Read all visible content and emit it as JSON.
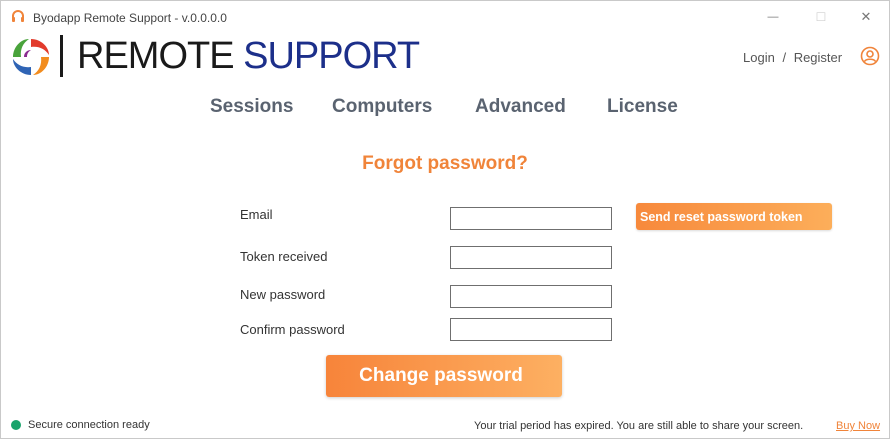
{
  "window": {
    "title": "Byodapp Remote Support - v.0.0.0.0",
    "minimize_glyph": "—",
    "maximize_glyph": "☐",
    "close_glyph": "✕"
  },
  "logo": {
    "word1": "REMOTE",
    "word2": "SUPPORT"
  },
  "auth": {
    "login_label": "Login",
    "separator": "/",
    "register_label": "Register",
    "icon": "user-circle-icon"
  },
  "nav": {
    "items": [
      {
        "label": "Sessions"
      },
      {
        "label": "Computers"
      },
      {
        "label": "Advanced"
      },
      {
        "label": "License"
      }
    ]
  },
  "form": {
    "heading": "Forgot password?",
    "email_label": "Email",
    "email_value": "",
    "token_label": "Token received",
    "token_value": "",
    "new_password_label": "New password",
    "new_password_value": "",
    "confirm_password_label": "Confirm password",
    "confirm_password_value": "",
    "send_token_button": "Send reset password token",
    "change_password_button": "Change password"
  },
  "status": {
    "connection_text": "Secure connection ready",
    "trial_text": "Your trial period has expired. You are still able to share your screen.",
    "buy_now_label": "Buy Now"
  },
  "colors": {
    "accent": "#f0843a",
    "brand_blue": "#1c2f8a",
    "status_green": "#1aa36b",
    "nav_text": "#5a6370"
  }
}
